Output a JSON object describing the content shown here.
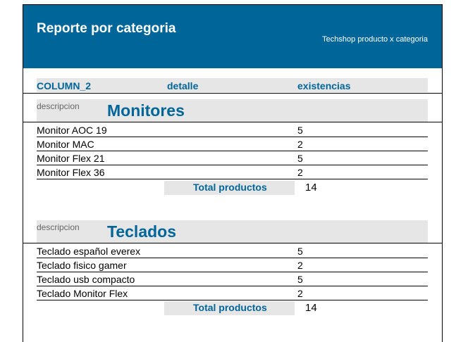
{
  "report": {
    "title": "Reporte por categoria",
    "subtitle": "Techshop producto x categoria"
  },
  "columns": {
    "col1": "COLUMN_2",
    "col2": "detalle",
    "col3": "existencias"
  },
  "groups": [
    {
      "label": "descripcion",
      "name": "Monitores",
      "rows": [
        {
          "name": "Monitor AOC 19",
          "qty": "5"
        },
        {
          "name": "Monitor MAC",
          "qty": "2"
        },
        {
          "name": "Monitor Flex 21",
          "qty": "5"
        },
        {
          "name": "Monitor Flex 36",
          "qty": "2"
        }
      ],
      "total_label": "Total productos",
      "total_value": "14"
    },
    {
      "label": "descripcion",
      "name": "Teclados",
      "rows": [
        {
          "name": "Teclado español everex",
          "qty": "5"
        },
        {
          "name": "Teclado fisico gamer",
          "qty": "2"
        },
        {
          "name": "Teclado usb compacto",
          "qty": "5"
        },
        {
          "name": "Teclado Monitor Flex",
          "qty": "2"
        }
      ],
      "total_label": "Total productos",
      "total_value": "14"
    }
  ],
  "colors": {
    "accent": "#006699",
    "band": "#e6e6e6"
  }
}
